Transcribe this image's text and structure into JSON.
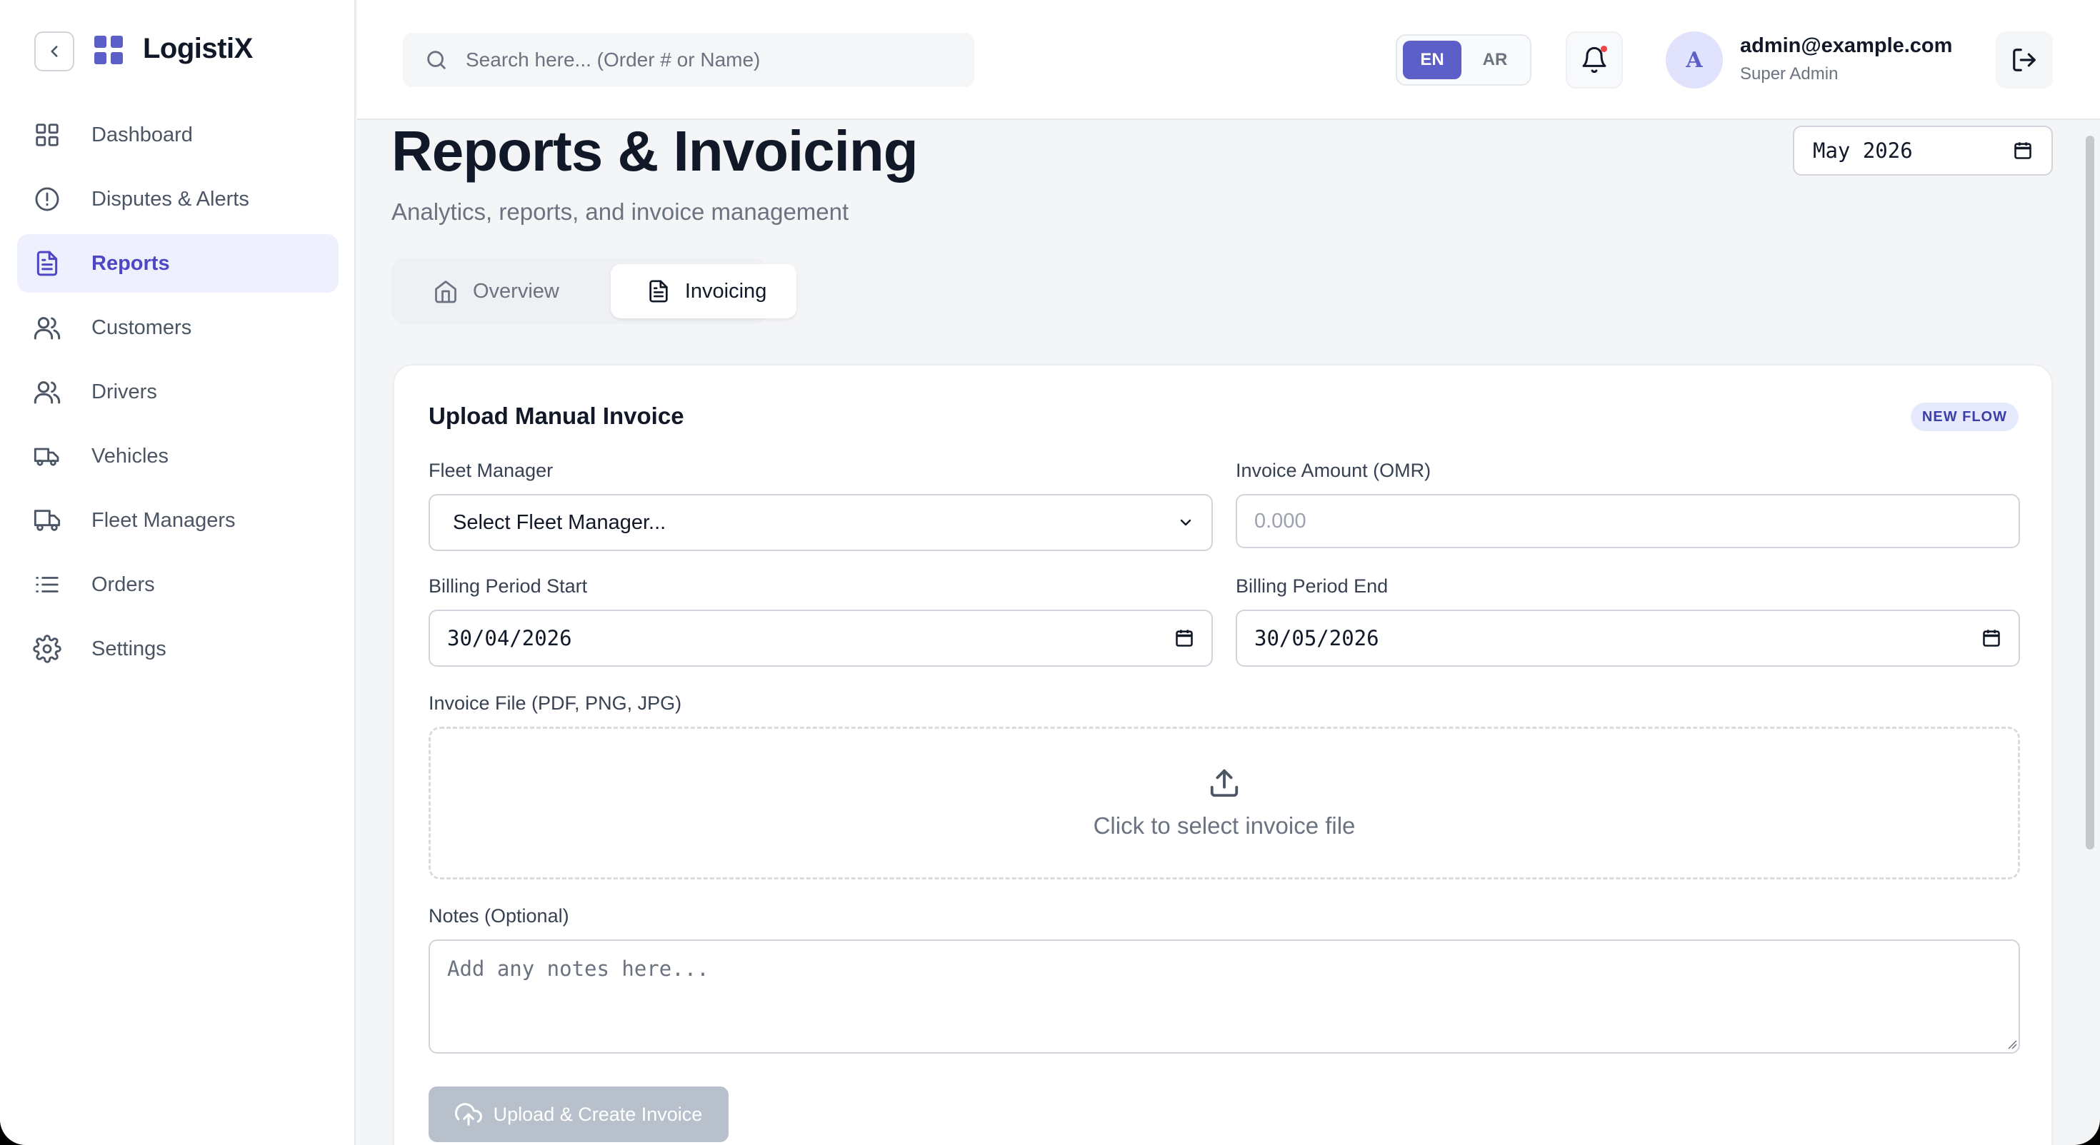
{
  "app": {
    "brand": "LogistiX"
  },
  "sidebar": {
    "items": [
      {
        "label": "Dashboard",
        "icon": "dashboard-icon"
      },
      {
        "label": "Disputes & Alerts",
        "icon": "alert-circle-icon"
      },
      {
        "label": "Reports",
        "icon": "file-text-icon",
        "active": true
      },
      {
        "label": "Customers",
        "icon": "users-icon"
      },
      {
        "label": "Drivers",
        "icon": "users-icon"
      },
      {
        "label": "Vehicles",
        "icon": "truck-icon"
      },
      {
        "label": "Fleet Managers",
        "icon": "truck-icon"
      },
      {
        "label": "Orders",
        "icon": "list-icon"
      },
      {
        "label": "Settings",
        "icon": "gear-icon"
      }
    ]
  },
  "header": {
    "search_placeholder": "Search here... (Order # or Name)",
    "lang": {
      "en": "EN",
      "ar": "AR",
      "active": "EN"
    },
    "user": {
      "initial": "A",
      "email": "admin@example.com",
      "role": "Super Admin"
    }
  },
  "page": {
    "title": "Reports & Invoicing",
    "subtitle": "Analytics, reports, and invoice management",
    "month": "May 2026",
    "tabs": [
      {
        "label": "Overview",
        "active": false
      },
      {
        "label": "Invoicing",
        "active": true
      }
    ]
  },
  "form": {
    "title": "Upload Manual Invoice",
    "badge": "NEW FLOW",
    "fleet_manager_label": "Fleet Manager",
    "fleet_manager_value": "Select Fleet Manager...",
    "amount_label": "Invoice Amount (OMR)",
    "amount_placeholder": "0.000",
    "period_start_label": "Billing Period Start",
    "period_start_value": "30/04/2026",
    "period_end_label": "Billing Period End",
    "period_end_value": "30/05/2026",
    "file_label": "Invoice File (PDF, PNG, JPG)",
    "file_prompt": "Click to select invoice file",
    "notes_label": "Notes (Optional)",
    "notes_placeholder": "Add any notes here...",
    "submit_label": "Upload & Create Invoice"
  },
  "colors": {
    "accent": "#5b5fc7",
    "active_nav_bg": "#eef0fd",
    "active_nav_text": "#4f46c5",
    "disabled_button": "#b8c0cc",
    "notification_dot": "#ef4444"
  }
}
